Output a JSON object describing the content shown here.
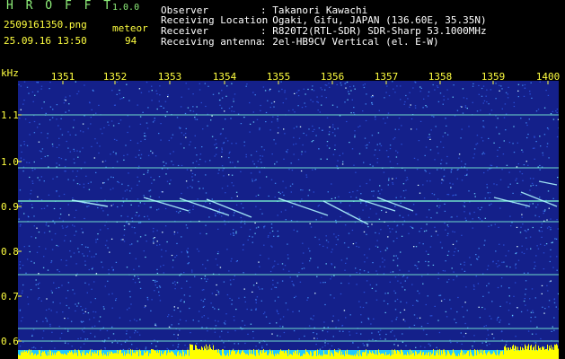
{
  "header": {
    "app_title": "H R O F F T",
    "version": "1.0.0",
    "filename": "2509161350.png",
    "datetime": "25.09.16 13:50",
    "meteor_label": "meteor",
    "meteor_count": "94",
    "info": [
      {
        "label": "Observer",
        "value": ": Takanori Kawachi"
      },
      {
        "label": "Receiving Location",
        "value": ": Ogaki, Gifu, JAPAN (136.60E, 35.35N)"
      },
      {
        "label": "Receiver",
        "value": ": R820T2(RTL-SDR) SDR-Sharp 53.1000MHz"
      },
      {
        "label": "Receiving antenna",
        "value": ": 2el-HB9CV Vertical (el. E-W)"
      }
    ]
  },
  "spectrogram": {
    "freq_unit": "kHz",
    "x_ticks": [
      "1351",
      "1352",
      "1353",
      "1354",
      "1355",
      "1356",
      "1357",
      "1358",
      "1359",
      "1400"
    ],
    "y_ticks": [
      "1.1",
      "1.0",
      "0.9",
      "0.8",
      "0.7",
      "0.6"
    ],
    "colors": {
      "background": "#14208a",
      "text": "#ffff40",
      "trace": "#7fffd4",
      "level": "#ffff00",
      "title": "#8ff07a"
    }
  }
}
